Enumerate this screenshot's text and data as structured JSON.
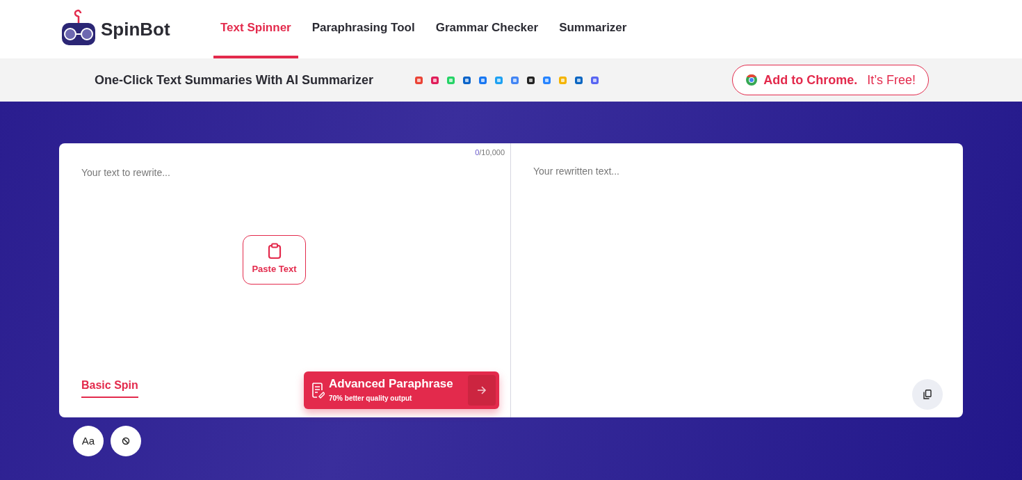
{
  "brand": "SpinBot",
  "nav": [
    {
      "label": "Text Spinner",
      "selected": true
    },
    {
      "label": "Paraphrasing Tool",
      "selected": false
    },
    {
      "label": "Grammar Checker",
      "selected": false
    },
    {
      "label": "Summarizer",
      "selected": false
    }
  ],
  "promo": {
    "headline": "One-Click Text Summaries With AI Summarizer",
    "cta_bold": "Add to Chrome.",
    "cta_light": "It’s Free!"
  },
  "input": {
    "placeholder": "Your text to rewrite...",
    "count": "0",
    "limit": "/10,000",
    "paste_label": "Paste Text"
  },
  "modes": [
    {
      "label": "Basic Spin",
      "selected": true
    }
  ],
  "advanced": {
    "title": "Advanced Paraphrase",
    "subtitle": "70% better quality output"
  },
  "output": {
    "placeholder": "Your rewritten text..."
  },
  "tools": [
    {
      "kind": "text",
      "label": "Aa"
    },
    {
      "kind": "clear"
    }
  ]
}
